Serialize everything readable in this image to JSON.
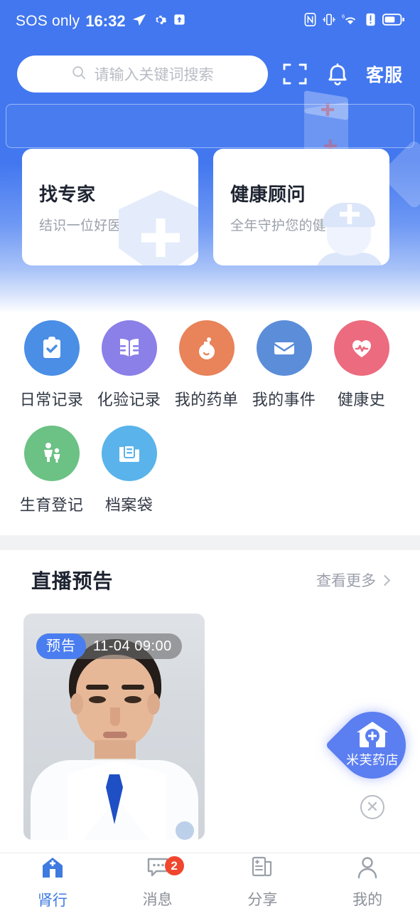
{
  "status_bar": {
    "carrier": "SOS only",
    "time": "16:32",
    "icons_left": [
      "location-arrow-icon",
      "gear-icon",
      "upload-box-icon"
    ],
    "icons_right": [
      "nfc-icon",
      "vibrate-icon",
      "wifi-6-icon",
      "alert-icon",
      "battery-icon"
    ]
  },
  "header": {
    "search": {
      "placeholder": "请输入关键词搜索",
      "icon": "search-icon"
    },
    "scan_icon": "scan-icon",
    "bell_icon": "bell-icon",
    "customer_service": "客服"
  },
  "feature_cards": [
    {
      "title": "找专家",
      "subtitle": "结识一位好医生",
      "art": "shield-plus-art"
    },
    {
      "title": "健康顾问",
      "subtitle": "全年守护您的健康",
      "art": "nurse-art"
    }
  ],
  "quick_grid": [
    {
      "label": "日常记录",
      "icon": "clipboard-check-icon",
      "color": "#4a8ee6"
    },
    {
      "label": "化验记录",
      "icon": "open-book-icon",
      "color": "#8b7fe8"
    },
    {
      "label": "我的药单",
      "icon": "pill-bottle-icon",
      "color": "#e8835a"
    },
    {
      "label": "我的事件",
      "icon": "briefcase-icon",
      "color": "#5b8dd9"
    },
    {
      "label": "健康史",
      "icon": "heart-pulse-icon",
      "color": "#ec6b7e"
    },
    {
      "label": "生育登记",
      "icon": "parent-child-icon",
      "color": "#6cc184"
    },
    {
      "label": "档案袋",
      "icon": "folder-doc-icon",
      "color": "#5ab3ea"
    }
  ],
  "live_section": {
    "title": "直播预告",
    "more_label": "查看更多",
    "more_icon": "chevron-right-icon",
    "cards": [
      {
        "tag": "预告",
        "time": "11-04 09:00",
        "thumbnail": "doctor-portrait"
      }
    ]
  },
  "floating_button": {
    "label": "米芙药店",
    "icon": "pharmacy-house-icon",
    "close_icon": "close-circle-icon",
    "color": "#5b7ef0"
  },
  "bottom_nav": [
    {
      "label": "肾行",
      "icon": "home-clinic-icon",
      "active": true,
      "badge": ""
    },
    {
      "label": "消息",
      "icon": "message-icon",
      "active": false,
      "badge": "2"
    },
    {
      "label": "分享",
      "icon": "share-doc-icon",
      "active": false,
      "badge": ""
    },
    {
      "label": "我的",
      "icon": "person-icon",
      "active": false,
      "badge": ""
    }
  ],
  "colors": {
    "header_blue": "#4277ef",
    "accent": "#3f7ae0",
    "badge_red": "#f0462d",
    "divider": "#f1f2f4"
  }
}
